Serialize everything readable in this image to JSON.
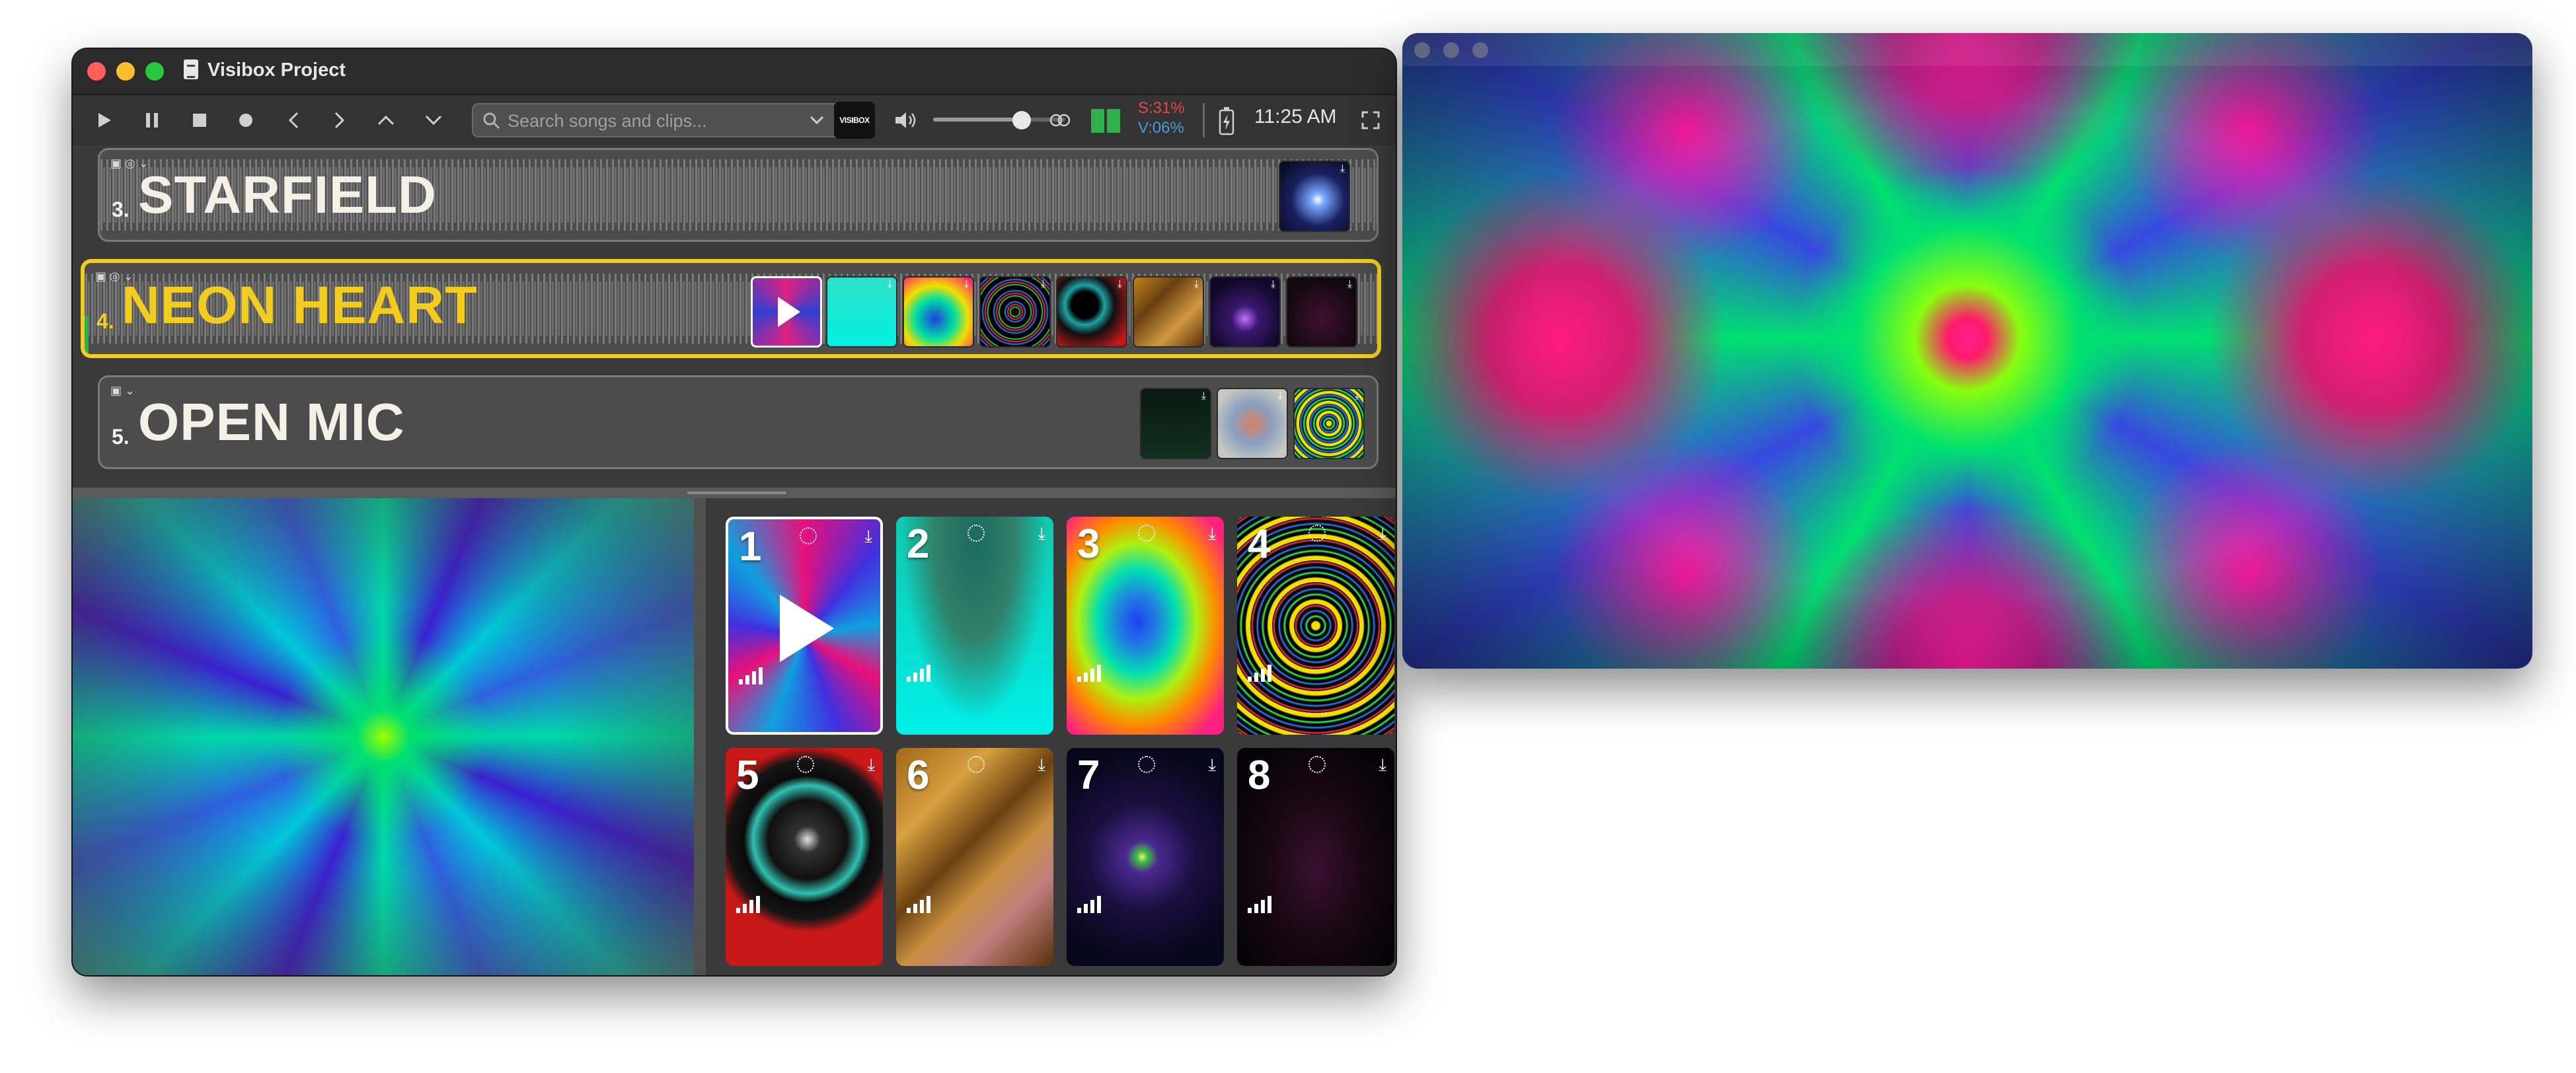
{
  "window": {
    "title": "Visibox Project"
  },
  "toolbar": {
    "search_placeholder": "Search songs and clips...",
    "logo_text": "VISIBOX",
    "stat_top": "S:31%",
    "stat_bottom": "V:06%",
    "clock": "11:25 AM",
    "icons": [
      "play-icon",
      "pause-icon",
      "stop-icon",
      "record-icon",
      "chevron-left-icon",
      "chevron-right-icon",
      "chevron-up-icon",
      "chevron-down-icon",
      "search-icon",
      "speaker-icon",
      "link-icon",
      "meter-icon",
      "battery-icon",
      "fullscreen-icon"
    ]
  },
  "songs": [
    {
      "number": "3.",
      "title": "STARFIELD",
      "active": false
    },
    {
      "number": "4.",
      "title": "NEON HEART",
      "active": true
    },
    {
      "number": "5.",
      "title": "OPEN MIC",
      "active": false
    }
  ],
  "clips": [
    {
      "number": "1",
      "selected": true
    },
    {
      "number": "2",
      "selected": false
    },
    {
      "number": "3",
      "selected": false
    },
    {
      "number": "4",
      "selected": false
    },
    {
      "number": "5",
      "selected": false
    },
    {
      "number": "6",
      "selected": false
    },
    {
      "number": "7",
      "selected": false
    },
    {
      "number": "8",
      "selected": false
    }
  ],
  "colors": {
    "accent_yellow": "#f2cc1e",
    "window_bg": "#3a3a3a",
    "stat_red": "#e64545",
    "stat_blue": "#4a9bd8"
  }
}
